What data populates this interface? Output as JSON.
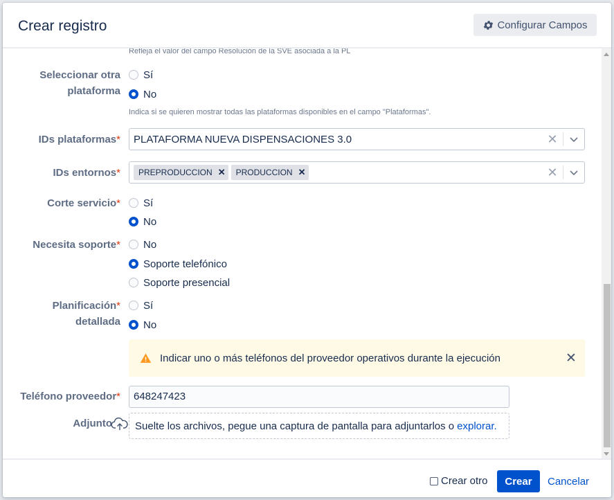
{
  "dialog": {
    "title": "Crear registro",
    "configure_label": "Configurar Campos"
  },
  "form": {
    "top_desc": "Refleja el valor del campo Resolución de la SVE asociada a la PL",
    "otra_plataforma": {
      "label_line1": "Seleccionar otra",
      "label_line2": "plataforma",
      "options": [
        "Sí",
        "No"
      ],
      "selected": "No",
      "desc": "Indica si se quieren mostrar todas las plataformas disponibles en el campo \"Plataformas\"."
    },
    "ids_plataformas": {
      "label": "IDs plataformas",
      "value": "PLATAFORMA NUEVA DISPENSACIONES 3.0"
    },
    "ids_entornos": {
      "label": "IDs entornos",
      "chips": [
        "PREPRODUCCION",
        "PRODUCCION"
      ]
    },
    "corte_servicio": {
      "label": "Corte servicio",
      "options": [
        "Sí",
        "No"
      ],
      "selected": "No"
    },
    "necesita_soporte": {
      "label": "Necesita soporte",
      "options": [
        "No",
        "Soporte telefónico",
        "Soporte presencial"
      ],
      "selected": "Soporte telefónico"
    },
    "planificacion": {
      "label_line1": "Planificación",
      "label_line2": "detallada",
      "options": [
        "Sí",
        "No"
      ],
      "selected": "No"
    },
    "warning": {
      "text": "Indicar uno o más teléfonos del proveedor operativos durante la ejecución",
      "close": "✕"
    },
    "telefono": {
      "label": "Teléfono proveedor",
      "value": "648247423"
    },
    "adjunto": {
      "label": "Adjunto",
      "drop_text": "Suelte los archivos, pegue una captura de pantalla para adjuntarlos o",
      "link": "explorar."
    },
    "required_mark": "*",
    "clear_glyph": "✕"
  },
  "footer": {
    "create_other": "Crear otro",
    "create": "Crear",
    "cancel": "Cancelar"
  },
  "colors": {
    "primary": "#0052cc",
    "required": "#de350b",
    "warning_bg": "#fffae6",
    "warning_icon": "#ff991f"
  }
}
